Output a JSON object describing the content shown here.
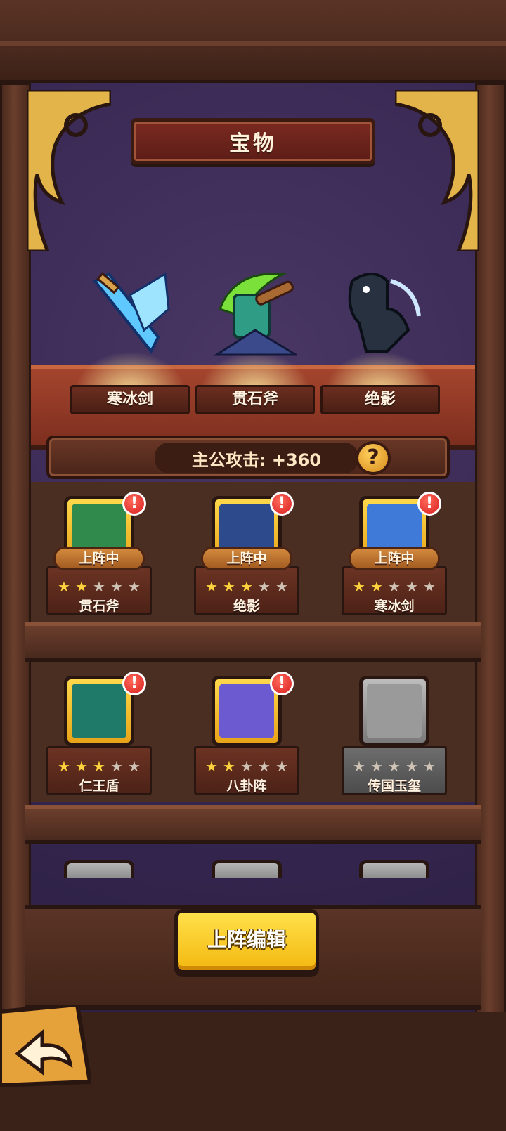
{
  "header": {
    "title": "宝物"
  },
  "featured": [
    {
      "name": "寒冰剑",
      "icon": "ice-sword-icon"
    },
    {
      "name": "贯石斧",
      "icon": "stone-axe-icon"
    },
    {
      "name": "绝影",
      "icon": "black-horse-icon"
    }
  ],
  "lord_attack": {
    "text": "主公攻击: +360",
    "help_symbol": "?"
  },
  "shelf_rows": [
    [
      {
        "name": "贯石斧",
        "status": "上阵中",
        "stars": 2,
        "max_stars": 5,
        "alert": "!",
        "locked": false,
        "icon": "stone-axe-icon"
      },
      {
        "name": "绝影",
        "status": "上阵中",
        "stars": 3,
        "max_stars": 5,
        "alert": "!",
        "locked": false,
        "icon": "black-horse-icon"
      },
      {
        "name": "寒冰剑",
        "status": "上阵中",
        "stars": 2,
        "max_stars": 5,
        "alert": "!",
        "locked": false,
        "icon": "ice-sword-icon"
      }
    ],
    [
      {
        "name": "仁王盾",
        "status": "",
        "stars": 3,
        "max_stars": 5,
        "alert": "!",
        "locked": false,
        "icon": "shield-icon"
      },
      {
        "name": "八卦阵",
        "status": "",
        "stars": 2,
        "max_stars": 5,
        "alert": "!",
        "locked": false,
        "icon": "bagua-icon"
      },
      {
        "name": "传国玉玺",
        "status": "",
        "stars": 0,
        "max_stars": 5,
        "alert": "",
        "locked": true,
        "icon": "jade-seal-icon"
      }
    ]
  ],
  "actions": {
    "edit_lineup": "上阵编辑",
    "back_icon": "back-arrow-icon"
  },
  "colors": {
    "gold_button": "#f3b80f",
    "frame_wood": "#4a2a1e",
    "back_wall": "#352650",
    "alert_red": "#d81f1f"
  }
}
